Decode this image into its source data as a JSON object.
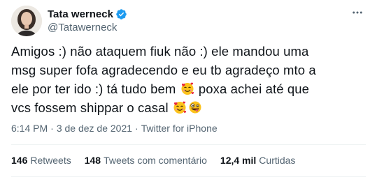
{
  "author": {
    "display_name": "Tata werneck",
    "handle": "@Tatawerneck",
    "verified": true
  },
  "tweet": {
    "lines": [
      "Amigos :) não ataquem fiuk não :) ele mandou uma",
      "msg super fofa agradecendo e eu tb agradeço mto a",
      "ele por ter ido :) tá tudo bem",
      "poxa achei até que",
      "vcs fossem shippar o casal"
    ],
    "emojis": [
      "smiling-face-with-hearts",
      "smiling-face-with-hearts",
      "zany-face"
    ]
  },
  "meta": {
    "time": "6:14 PM",
    "separator": "·",
    "date": "3 de dez de 2021",
    "source": "Twitter for iPhone"
  },
  "stats": {
    "retweets_count": "146",
    "retweets_label": "Retweets",
    "quotes_count": "148",
    "quotes_label": "Tweets com comentário",
    "likes_count": "12,4 mil",
    "likes_label": "Curtidas"
  },
  "colors": {
    "text": "#0f1419",
    "secondary": "#536471",
    "verified": "#1d9bf0",
    "divider": "#eff3f4"
  }
}
